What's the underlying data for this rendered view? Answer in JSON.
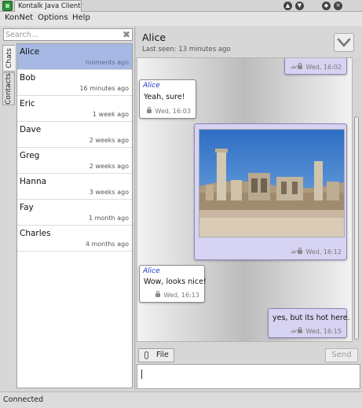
{
  "window": {
    "title": "Kontalk Java Client",
    "controls": [
      "minimize",
      "maximize",
      "shade",
      "close"
    ]
  },
  "menu": {
    "items": [
      "KonNet",
      "Options",
      "Help"
    ]
  },
  "side_tabs": {
    "chats": "Chats",
    "contacts": "Contacts"
  },
  "search": {
    "placeholder": "Search..."
  },
  "chat_list": [
    {
      "name": "Alice",
      "time": "moments ago",
      "selected": true
    },
    {
      "name": "Bob",
      "time": "16 minutes ago"
    },
    {
      "name": "Eric",
      "time": "1 week ago"
    },
    {
      "name": "Dave",
      "time": "2 weeks ago"
    },
    {
      "name": "Greg",
      "time": "2 weeks ago"
    },
    {
      "name": "Hanna",
      "time": "3 weeks ago"
    },
    {
      "name": "Fay",
      "time": "1 month ago"
    },
    {
      "name": "Charles",
      "time": "4 months ago"
    }
  ],
  "chat": {
    "title": "Alice",
    "last_seen": "Last seen: 13 minutes ago"
  },
  "messages": [
    {
      "direction": "out",
      "text": "",
      "meta": "Wed, 16:02",
      "status_icon": "delivered-icon"
    },
    {
      "direction": "in",
      "sender": "Alice",
      "text": "Yeah, sure!",
      "meta": "Wed, 16:03"
    },
    {
      "direction": "out",
      "attachment": "photo-ruins",
      "meta": "Wed, 16:12",
      "status_icon": "delivered-icon"
    },
    {
      "direction": "in",
      "sender": "Alice",
      "text": "Wow, looks nice!",
      "meta": "Wed, 16:13"
    },
    {
      "direction": "out",
      "text": "yes, but its hot here.",
      "meta": "Wed, 16:15",
      "status_icon": "delivered-icon"
    }
  ],
  "composer": {
    "file_label": "File",
    "send_label": "Send",
    "text": ""
  },
  "status": {
    "text": "Connected"
  },
  "colors": {
    "selection": "#a6b8e3",
    "outgoing_bubble": "#d7d3f2",
    "sender_name": "#1f35c5"
  }
}
